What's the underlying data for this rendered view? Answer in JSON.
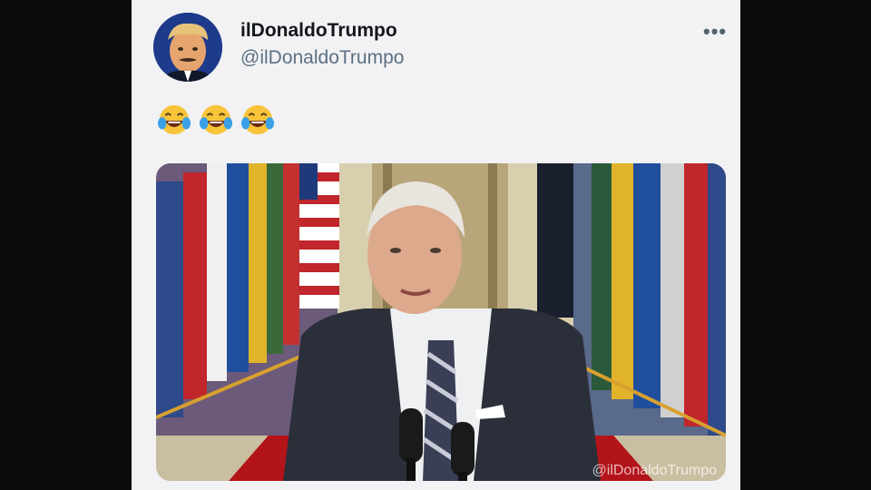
{
  "tweet": {
    "display_name": "ilDonaldoTrumpo",
    "handle": "@ilDonaldoTrumpo",
    "more_label": "•••",
    "text_emojis": [
      "laughing-crying-emoji",
      "laughing-crying-emoji",
      "laughing-crying-emoji"
    ]
  },
  "media": {
    "watermark": "@ilDonaldoTrumpo"
  },
  "colors": {
    "background_bars": "#0b0b0b",
    "card": "#f2f2f4",
    "name": "#14171a",
    "handle": "#5b7083",
    "carpet": "#b3141a"
  }
}
